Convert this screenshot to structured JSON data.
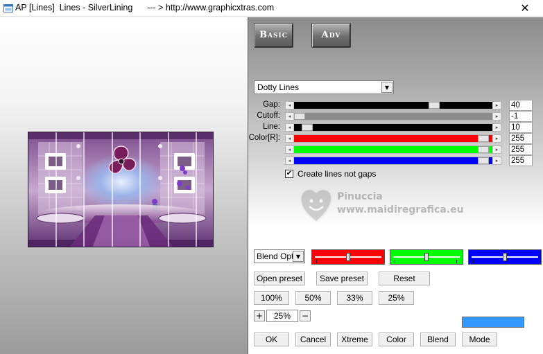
{
  "window": {
    "title": "AP [Lines]  Lines - SilverLining      --- > http://www.graphicxtras.com",
    "close_glyph": "✕"
  },
  "tabs": [
    {
      "label": "Basic"
    },
    {
      "label": "Adv"
    }
  ],
  "mode": {
    "selected": "Dotty Lines"
  },
  "params": [
    {
      "label": "Gap:",
      "value": "40",
      "color": "#000000",
      "thumb_pos": 0.72
    },
    {
      "label": "Cutoff:",
      "value": "-1",
      "color": "#8c8c8c",
      "thumb_pos": 0.0
    },
    {
      "label": "Line:",
      "value": "10",
      "color": "#000000",
      "thumb_pos": 0.04
    },
    {
      "label": "Color[R]:",
      "value": "255",
      "color": "#ff0000",
      "thumb_pos": 0.98
    },
    {
      "label": "",
      "value": "255",
      "color": "#00ff00",
      "thumb_pos": 0.98
    },
    {
      "label": "",
      "value": "255",
      "color": "#0000ff",
      "thumb_pos": 0.98
    }
  ],
  "checkbox": {
    "label": "Create lines not gaps",
    "checked": true,
    "mark": "✔"
  },
  "watermark": {
    "name": "Pinuccia",
    "url": "www.maidiregrafica.eu"
  },
  "blend": {
    "selected": "Blend Opti"
  },
  "swatches": [
    {
      "color": "#ff0000",
      "thumb": 0.5
    },
    {
      "color": "#00ff00",
      "thumb": 0.5
    },
    {
      "color": "#0000ff",
      "thumb": 0.5
    }
  ],
  "buttons": {
    "open_preset": "Open preset",
    "save_preset": "Save preset",
    "reset": "Reset",
    "z100": "100%",
    "z50": "50%",
    "z33": "33%",
    "z25": "25%",
    "ok": "OK",
    "cancel": "Cancel",
    "xtreme": "Xtreme",
    "color": "Color",
    "blend": "Blend",
    "mode": "Mode"
  },
  "zoom": {
    "value": "25%",
    "plus": "+",
    "minus": "−"
  },
  "preview_color": "#3399ff",
  "icons": {
    "dropdown": "▼",
    "slider_left": "◂",
    "slider_right": "▸"
  }
}
